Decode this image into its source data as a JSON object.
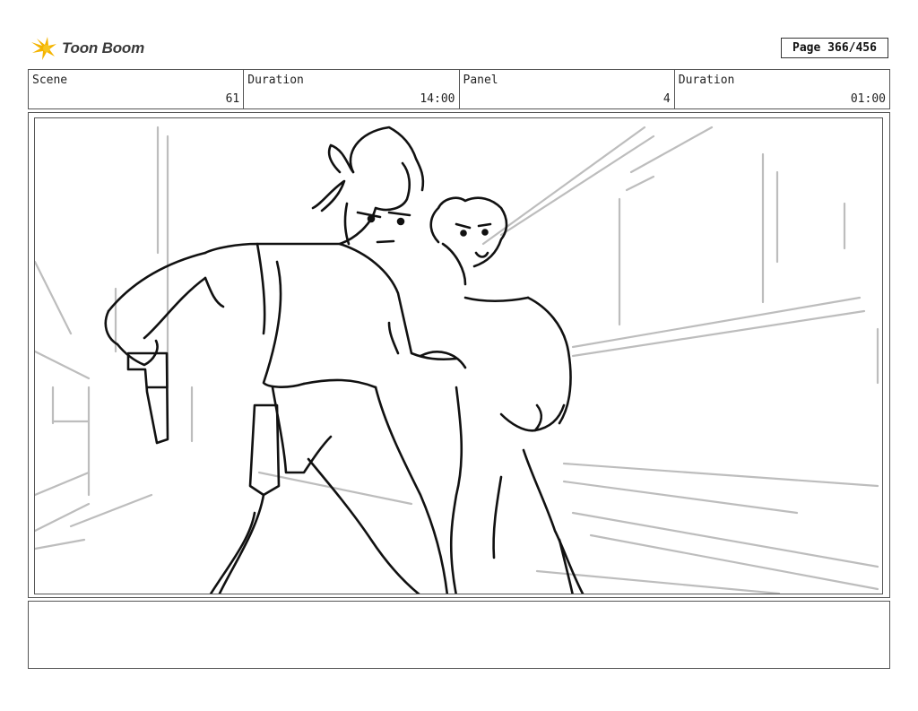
{
  "brand": {
    "name": "Toon Boom",
    "icon": "toon-boom-star-logo",
    "accent": "#f4b400"
  },
  "page_indicator": "Page 366/456",
  "info": {
    "scene_label": "Scene",
    "scene_value": "61",
    "scene_duration_label": "Duration",
    "scene_duration_value": "14:00",
    "panel_label": "Panel",
    "panel_value": "4",
    "panel_duration_label": "Duration",
    "panel_duration_value": "01:00"
  },
  "panel_image": {
    "description_icon": "storyboard-sketch-two-characters-with-gun"
  },
  "notes": {
    "text": ""
  }
}
